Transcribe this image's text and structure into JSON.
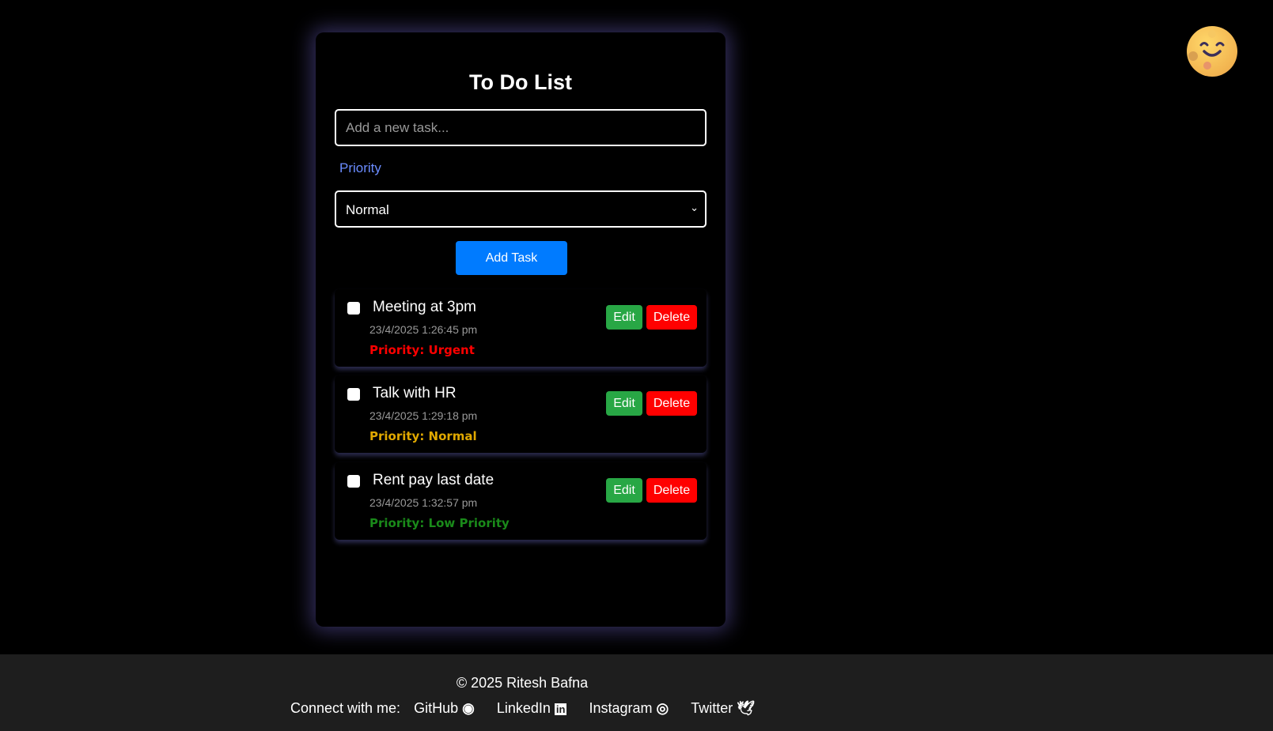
{
  "title": "To Do List",
  "input": {
    "placeholder": "Add a new task...",
    "value": ""
  },
  "priority_label": "Priority",
  "priority_select": "Normal",
  "add_button": "Add Task",
  "tasks": [
    {
      "name": "Meeting at 3pm",
      "time": "23/4/2025 1:26:45 pm",
      "priority": "Priority: Urgent",
      "color": "#ff0000"
    },
    {
      "name": "Talk with HR",
      "time": "23/4/2025 1:29:18 pm",
      "priority": "Priority: Normal",
      "color": "#e0a800"
    },
    {
      "name": "Rent pay last date",
      "time": "23/4/2025 1:32:57 pm",
      "priority": "Priority: Low Priority",
      "color": "#1a8a1a"
    }
  ],
  "edit_label": "Edit",
  "delete_label": "Delete",
  "footer": {
    "copyright": "© 2025 Ritesh Bafna",
    "connect": "Connect with me:",
    "links": [
      "GitHub",
      "LinkedIn",
      "Instagram",
      "Twitter"
    ]
  }
}
